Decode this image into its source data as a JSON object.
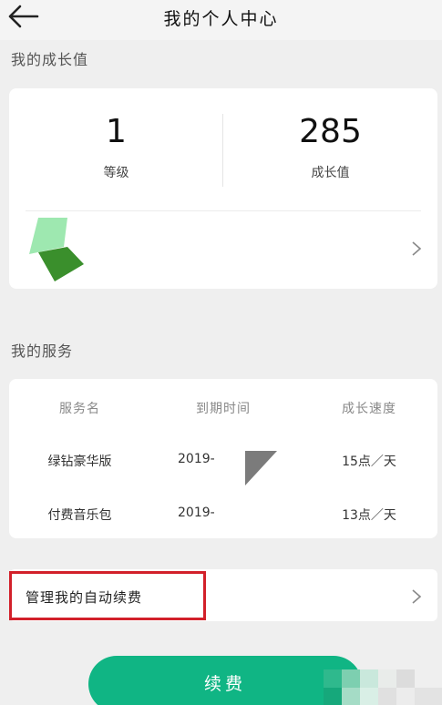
{
  "header": {
    "title": "我的个人中心"
  },
  "growth": {
    "section_title": "我的成长值",
    "level_value": "1",
    "level_label": "等级",
    "points_value": "285",
    "points_label": "成长值"
  },
  "services": {
    "section_title": "我的服务",
    "columns": [
      "服务名",
      "到期时间",
      "成长速度"
    ],
    "rows": [
      {
        "name": "绿钻豪华版",
        "expiry": "2019-",
        "speed": "15点／天"
      },
      {
        "name": "付费音乐包",
        "expiry": "2019-",
        "speed": "13点／天"
      }
    ]
  },
  "auto_renew": {
    "label": "管理我的自动续费"
  },
  "renew_button": {
    "label": "续费"
  },
  "colors": {
    "accent_green": "#10b584",
    "highlight_red": "#d2202a",
    "badge_light": "#9ee8b0",
    "badge_dark": "#3a8f2c"
  },
  "icons": [
    "back-arrow-icon",
    "level-badge-icon",
    "chevron-right-icon"
  ]
}
